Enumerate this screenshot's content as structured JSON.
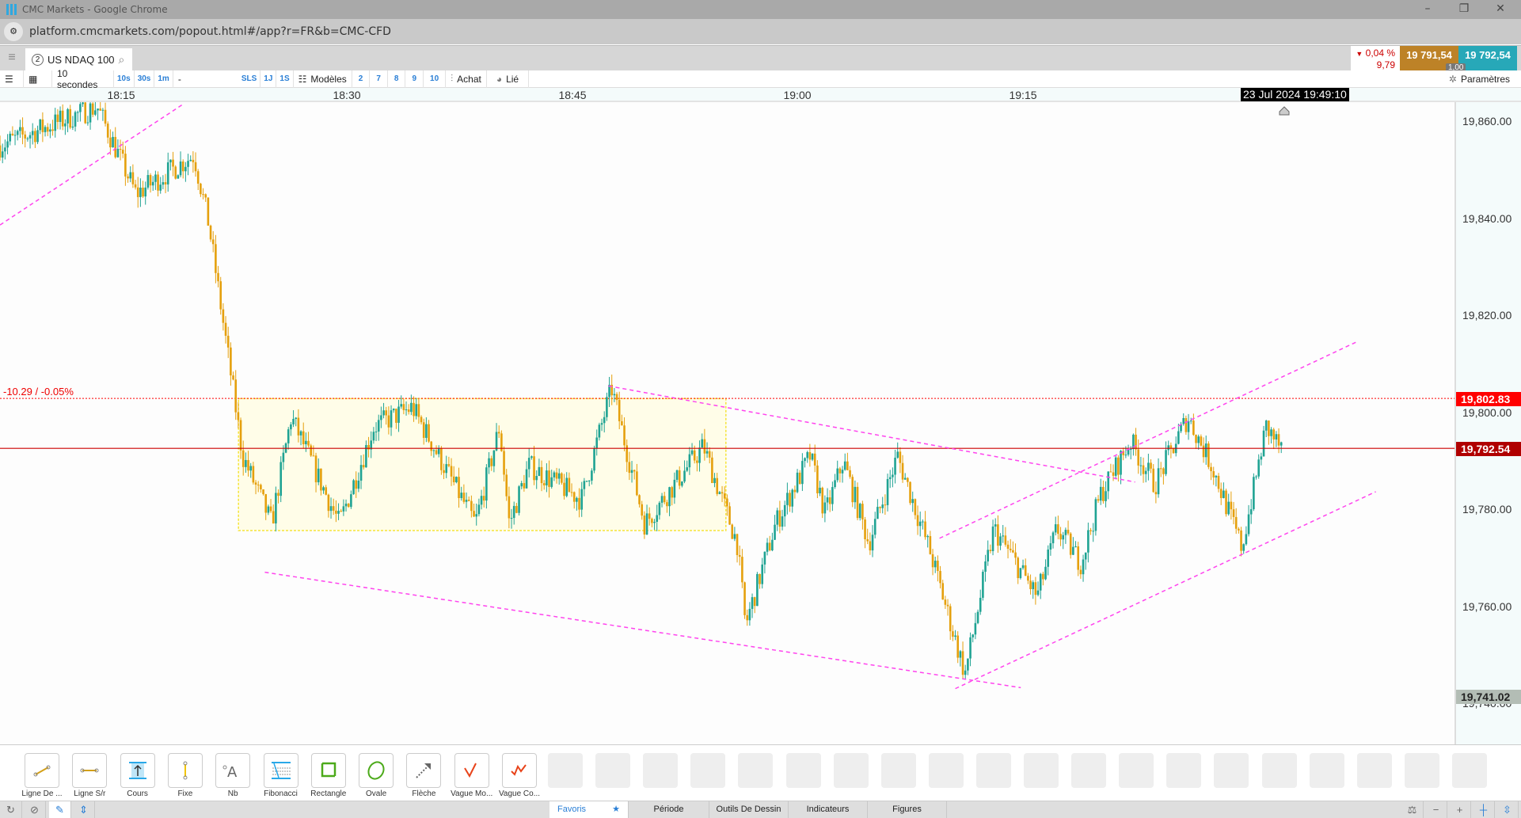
{
  "window": {
    "title": "CMC Markets - Google Chrome",
    "url": "platform.cmcmarkets.com/popout.html#/app?r=FR&b=CMC-CFD"
  },
  "instrument": {
    "index": "2",
    "name": "US NDAQ 100"
  },
  "quote": {
    "change_pct": "0,04 %",
    "change_pts": "9,79",
    "sell": "19 791,54",
    "buy": "19 792,54",
    "spread": "1,00",
    "colors": {
      "sell": "#bd8227",
      "buy": "#27a8b8",
      "down": "#cc0000"
    }
  },
  "toolbar": {
    "interval": "10 secondes",
    "quick_intervals": [
      "10s",
      "30s",
      "1m",
      "-"
    ],
    "ranges": [
      "SLS",
      "1J",
      "1S"
    ],
    "templates": "Modèles",
    "presets": [
      "2",
      "7",
      "8",
      "9",
      "10"
    ],
    "price_type": "Achat",
    "linked": "Lié",
    "settings": "Paramètres"
  },
  "time_axis": {
    "labels": [
      "18:15",
      "18:30",
      "18:45",
      "19:00",
      "19:15"
    ],
    "crosshair": "23 Jul 2024 19:49:10"
  },
  "price_axis": {
    "labels": [
      "19,860.00",
      "19,840.00",
      "19,820.00",
      "19,800.00",
      "19,780.00",
      "19,760.00",
      "19,740.00"
    ],
    "tags": {
      "level": "19,802.83",
      "current": "19,792.54",
      "low": "19,741.02"
    }
  },
  "level_line": {
    "label": "-10.29 / -0.05%"
  },
  "chart_data": {
    "type": "candlestick",
    "interval_seconds": 10,
    "x_unit": "minutes since 18:00",
    "path": [
      [
        6.95,
        19855
      ],
      [
        13.4,
        19863
      ],
      [
        15.98,
        19845
      ],
      [
        19.84,
        19853
      ],
      [
        20.81,
        19839
      ],
      [
        22.42,
        19805
      ],
      [
        23.07,
        19791
      ],
      [
        25.0,
        19777
      ],
      [
        26.3,
        19799
      ],
      [
        29.5,
        19777
      ],
      [
        31.8,
        19797
      ],
      [
        34.35,
        19801
      ],
      [
        38.54,
        19777
      ],
      [
        40.15,
        19797
      ],
      [
        40.8,
        19777
      ],
      [
        42.1,
        19789
      ],
      [
        45.6,
        19782
      ],
      [
        47.6,
        19805
      ],
      [
        49.8,
        19777
      ],
      [
        53.7,
        19793
      ],
      [
        55.95,
        19773
      ],
      [
        56.5,
        19756
      ],
      [
        58.5,
        19777
      ],
      [
        60.8,
        19791
      ],
      [
        61.8,
        19779
      ],
      [
        63.0,
        19790
      ],
      [
        64.7,
        19773
      ],
      [
        66.6,
        19791
      ],
      [
        68.8,
        19771
      ],
      [
        71.1,
        19746
      ],
      [
        73.0,
        19776
      ],
      [
        75.9,
        19762
      ],
      [
        77.2,
        19776
      ],
      [
        78.8,
        19769
      ],
      [
        80.1,
        19783
      ],
      [
        82.1,
        19794
      ],
      [
        83.7,
        19785
      ],
      [
        85.9,
        19799
      ],
      [
        87.5,
        19789
      ],
      [
        89.5,
        19772
      ],
      [
        91.1,
        19797
      ],
      [
        92.2,
        19792
      ]
    ],
    "ylim": [
      19733,
      19866
    ],
    "level": 19802.83,
    "current": 19792.54,
    "drawings": {
      "lines": [
        [
          [
            6.95,
            19838.6
          ],
          [
            19.07,
            19863.4
          ]
        ],
        [
          [
            24.55,
            19767
          ],
          [
            74.8,
            19743.2
          ]
        ],
        [
          [
            47.4,
            19805.4
          ],
          [
            82.4,
            19785.6
          ]
        ],
        [
          [
            69.4,
            19774
          ],
          [
            97.2,
            19814.6
          ]
        ],
        [
          [
            70.45,
            19743
          ],
          [
            98.4,
            19783.6
          ]
        ]
      ],
      "rectangle": [
        [
          22.8,
          19802.8
        ],
        [
          55.2,
          19775.6
        ]
      ]
    },
    "colors": {
      "up": "#1fa393",
      "down": "#e5a00d",
      "drawing": "#ff44ee",
      "rect": "#fffde8",
      "level": "#ff0000",
      "current": "#cc0000"
    }
  },
  "draw_tools": [
    "Ligne De ...",
    "Ligne S/r",
    "Cours",
    "Fixe",
    "Nb",
    "Fibonacci",
    "Rectangle",
    "Ovale",
    "Flèche",
    "Vague Mo...",
    "Vague Co..."
  ],
  "bottom_tabs": [
    "Favoris",
    "Période",
    "Outils De Dessin",
    "Indicateurs",
    "Figures"
  ]
}
